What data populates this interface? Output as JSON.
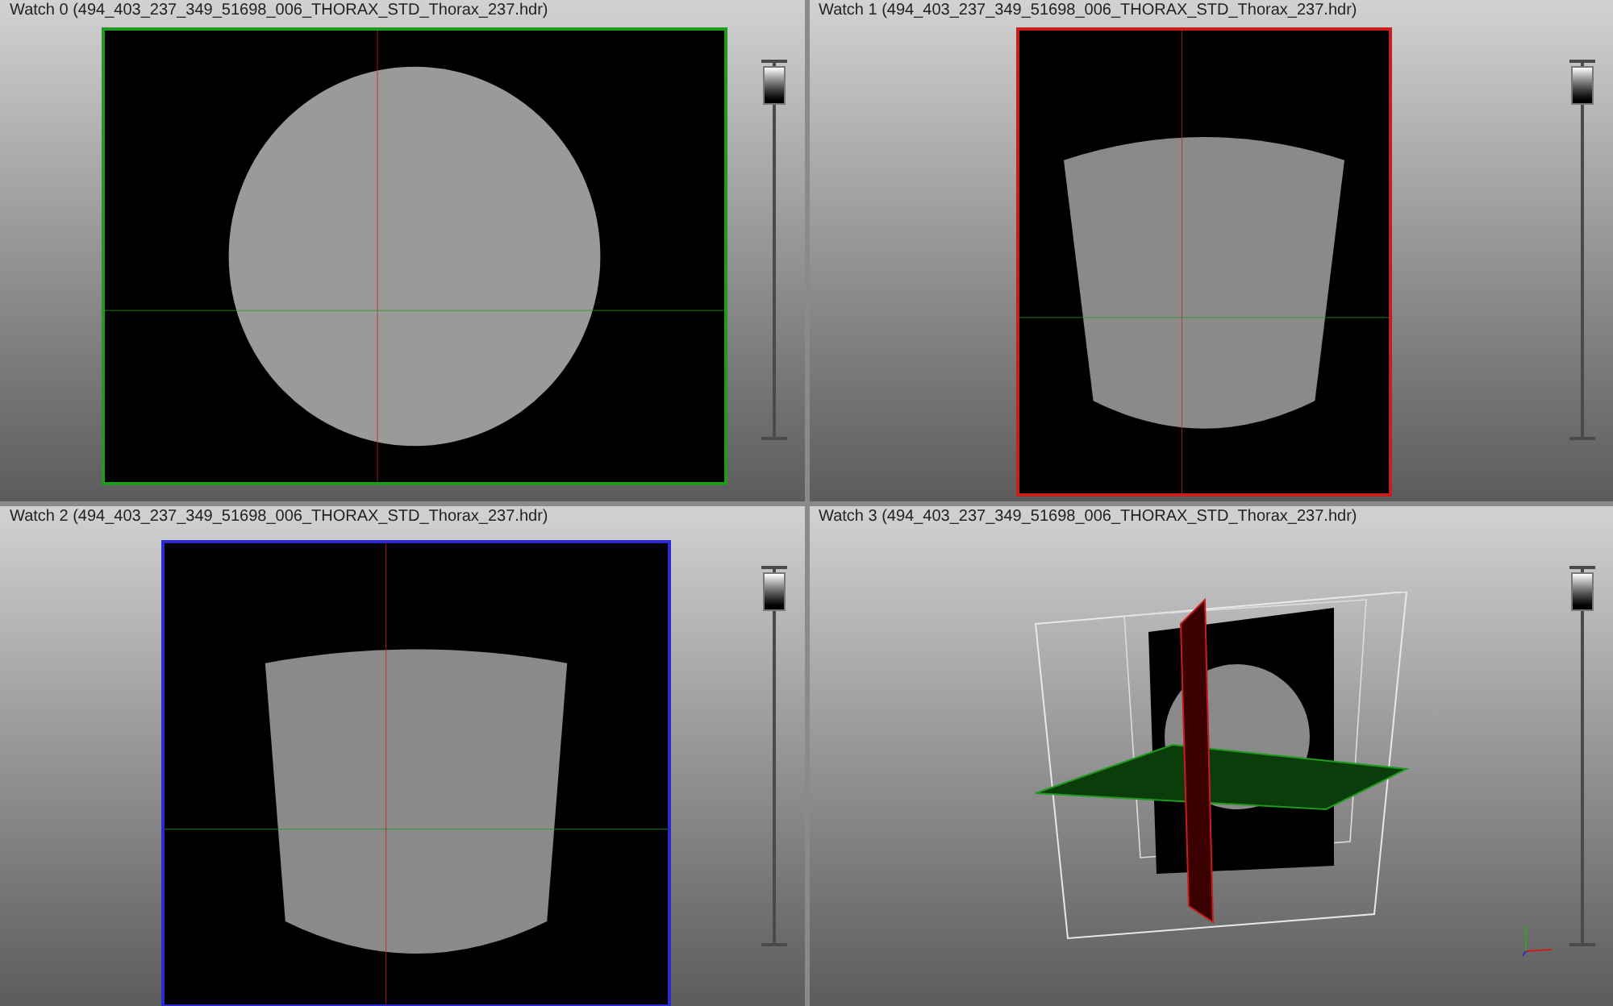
{
  "panes": [
    {
      "title": "Watch 0 (494_403_237_349_51698_006_THORAX_STD_Thorax_237.hdr)",
      "kind": "slice",
      "color": "#1f9a1f",
      "slider": {
        "level": 1
      }
    },
    {
      "title": "Watch 1 (494_403_237_349_51698_006_THORAX_STD_Thorax_237.hdr)",
      "kind": "slice",
      "color": "#c81e1e",
      "slider": {
        "level": 1
      }
    },
    {
      "title": "Watch 2 (494_403_237_349_51698_006_THORAX_STD_Thorax_237.hdr)",
      "kind": "slice",
      "color": "#2a2ad0",
      "slider": {
        "level": 1
      }
    },
    {
      "title": "Watch 3 (494_403_237_349_51698_006_THORAX_STD_Thorax_237.hdr)",
      "kind": "volume",
      "slider": {
        "level": 1
      }
    }
  ]
}
